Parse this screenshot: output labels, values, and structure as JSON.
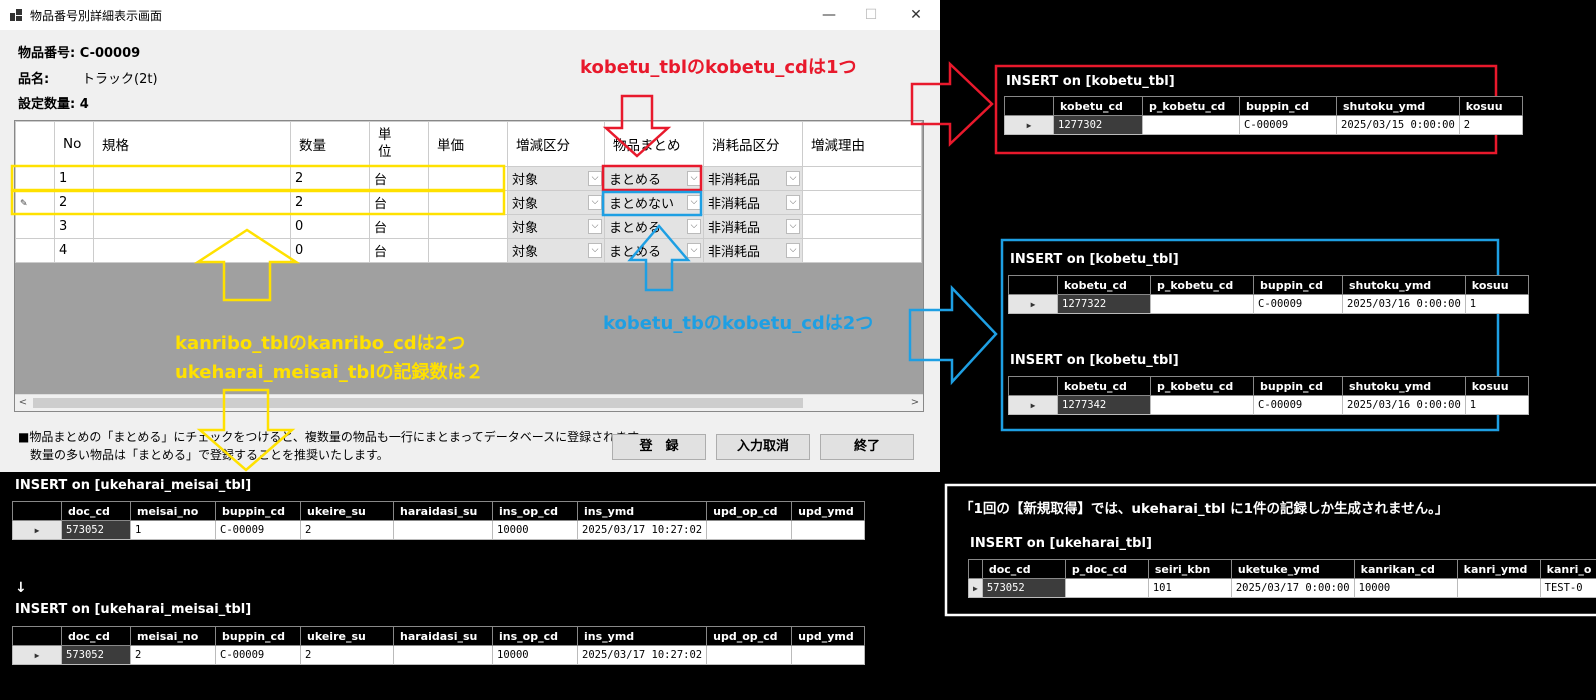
{
  "window": {
    "title": "物品番号別詳細表示画面",
    "minimize": "—",
    "maximize": "☐",
    "close": "✕"
  },
  "info": {
    "item_no_label": "物品番号:",
    "item_no": "C-00009",
    "name_label": "品名:",
    "name": "トラック(2t)",
    "qty_label": "設定数量:",
    "qty": "4"
  },
  "grid": {
    "headers": [
      "No",
      "規格",
      "数量",
      "単\n位",
      "単価",
      "増減区分",
      "物品まとめ",
      "消耗品区分",
      "増減理由"
    ],
    "rows": [
      {
        "no": "1",
        "kikaku": "",
        "suryo": "2",
        "tani": "台",
        "tanka": "",
        "zougen": "対象",
        "matome": "まとめる",
        "shomo": "非消耗品",
        "riyu": "",
        "edit": ""
      },
      {
        "no": "2",
        "kikaku": "",
        "suryo": "2",
        "tani": "台",
        "tanka": "",
        "zougen": "対象",
        "matome": "まとめない",
        "shomo": "非消耗品",
        "riyu": "",
        "edit": "✎"
      },
      {
        "no": "3",
        "kikaku": "",
        "suryo": "0",
        "tani": "台",
        "tanka": "",
        "zougen": "対象",
        "matome": "まとめる",
        "shomo": "非消耗品",
        "riyu": "",
        "edit": ""
      },
      {
        "no": "4",
        "kikaku": "",
        "suryo": "0",
        "tani": "台",
        "tanka": "",
        "zougen": "対象",
        "matome": "まとめる",
        "shomo": "非消耗品",
        "riyu": "",
        "edit": ""
      }
    ]
  },
  "note": {
    "line1": "■物品まとめの「まとめる」にチェックをつけると、複数量の物品も一行にまとまってデータベースに登録されます。",
    "line2": "数量の多い物品は「まとめる」で登録することを推奨いたします。"
  },
  "buttons": {
    "register": "登　録",
    "cancel_input": "入力取消",
    "exit": "終了"
  },
  "annotations": {
    "red": "kobetu_tblのkobetu_cdは1つ",
    "blue": "kobetu_tbのkobetu_cdは2つ",
    "yellow1": "kanribo_tblのkanribo_cdは2つ",
    "yellow2": "ukeharai_meisai_tblの記録数は２",
    "white": "「1回の【新規取得】では、ukeharai_tbl に1件の記録しか生成されません。」",
    "down_arrow": "↓"
  },
  "colors": {
    "red": "#e8192c",
    "blue": "#1e9fe3",
    "yellow": "#ffe100",
    "white": "#ffffff"
  },
  "db_tables": {
    "kobetu_red": {
      "title": "INSERT on [kobetu_tbl]",
      "cols": [
        "kobetu_cd",
        "p_kobetu_cd",
        "buppin_cd",
        "shutoku_ymd",
        "kosuu"
      ],
      "row": [
        "1277302",
        "",
        "C-00009",
        "2025/03/15 0:00:00",
        "2"
      ]
    },
    "kobetu_blue1": {
      "title": "INSERT on [kobetu_tbl]",
      "cols": [
        "kobetu_cd",
        "p_kobetu_cd",
        "buppin_cd",
        "shutoku_ymd",
        "kosuu"
      ],
      "row": [
        "1277322",
        "",
        "C-00009",
        "2025/03/16 0:00:00",
        "1"
      ]
    },
    "kobetu_blue2": {
      "title": "INSERT on [kobetu_tbl]",
      "cols": [
        "kobetu_cd",
        "p_kobetu_cd",
        "buppin_cd",
        "shutoku_ymd",
        "kosuu"
      ],
      "row": [
        "1277342",
        "",
        "C-00009",
        "2025/03/16 0:00:00",
        "1"
      ]
    },
    "meisai1": {
      "title": "INSERT on [ukeharai_meisai_tbl]",
      "cols": [
        "doc_cd",
        "meisai_no",
        "buppin_cd",
        "ukeire_su",
        "haraidasi_su",
        "ins_op_cd",
        "ins_ymd",
        "upd_op_cd",
        "upd_ymd"
      ],
      "row": [
        "573052",
        "1",
        "C-00009",
        "2",
        "",
        "10000",
        "2025/03/17 10:27:02",
        "",
        ""
      ]
    },
    "meisai2": {
      "title": "INSERT on [ukeharai_meisai_tbl]",
      "cols": [
        "doc_cd",
        "meisai_no",
        "buppin_cd",
        "ukeire_su",
        "haraidasi_su",
        "ins_op_cd",
        "ins_ymd",
        "upd_op_cd",
        "upd_ymd"
      ],
      "row": [
        "573052",
        "2",
        "C-00009",
        "2",
        "",
        "10000",
        "2025/03/17 10:27:02",
        "",
        ""
      ]
    },
    "ukeharai": {
      "title": "INSERT on [ukeharai_tbl]",
      "cols": [
        "doc_cd",
        "p_doc_cd",
        "seiri_kbn",
        "uketuke_ymd",
        "kanrikan_cd",
        "kanri_ymd",
        "kanri_o"
      ],
      "row": [
        "573052",
        "",
        "101",
        "2025/03/17 0:00:00",
        "10000",
        "",
        "TEST-0"
      ]
    }
  }
}
